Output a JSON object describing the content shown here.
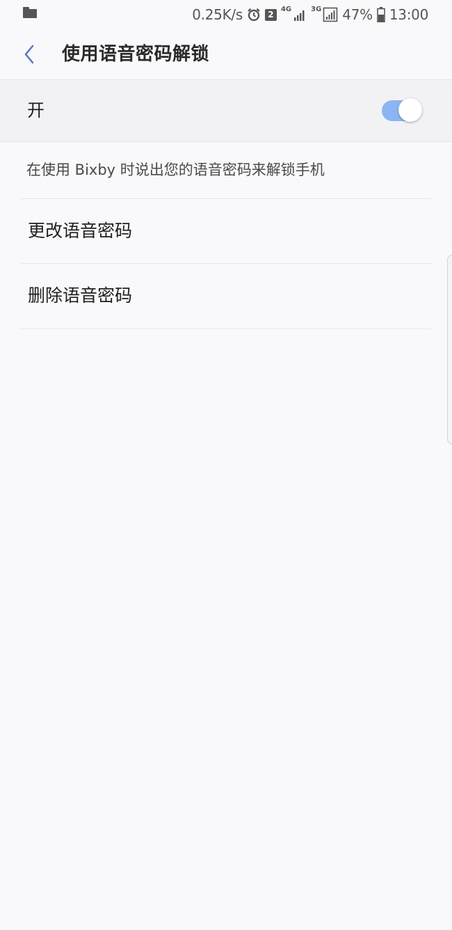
{
  "status_bar": {
    "net_speed": "0.25K/s",
    "sim_badge": "2",
    "net_4g": "4G",
    "net_3g": "3G",
    "battery": "47%",
    "time": "13:00",
    "icons": [
      "folder-icon",
      "alarm-icon",
      "sim-icon",
      "signal-icon",
      "battery-icon"
    ]
  },
  "header": {
    "title": "使用语音密码解锁",
    "back_icon": "chevron-left-icon"
  },
  "master_switch": {
    "label": "开",
    "state": "on",
    "track_color": "#8cb6f3"
  },
  "description": "在使用 Bixby 时说出您的语音密码来解锁手机",
  "menu": [
    {
      "label": "更改语音密码"
    },
    {
      "label": "删除语音密码"
    }
  ]
}
